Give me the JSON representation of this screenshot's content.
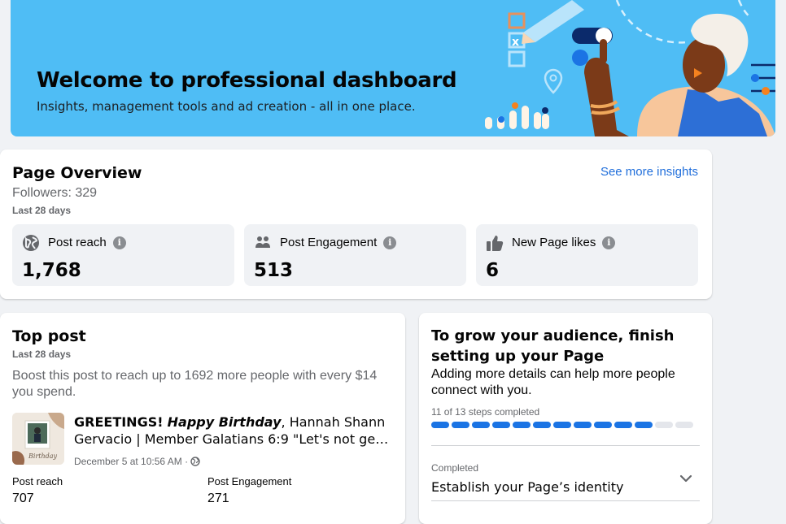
{
  "banner": {
    "title": "Welcome to professional dashboard",
    "subtitle": "Insights, management tools and ad creation - all in one place."
  },
  "overview": {
    "title": "Page Overview",
    "followers": "Followers: 329",
    "period": "Last 28 days",
    "link": "See more insights",
    "metrics": [
      {
        "icon": "globe-icon",
        "label": "Post reach",
        "value": "1,768"
      },
      {
        "icon": "people-icon",
        "label": "Post Engagement",
        "value": "513"
      },
      {
        "icon": "thumbs-up-icon",
        "label": "New Page likes",
        "value": "6"
      }
    ]
  },
  "top_post": {
    "title": "Top post",
    "period": "Last 28 days",
    "boost": "Boost this post to reach up to 1692 more people with every $14 you spend.",
    "text_bold": "GREETINGS!",
    "text_italic": "Happy Birthday",
    "text_rest": ", Hannah Shann",
    "text_line2": "Gervacio | Member Galatians 6:9 \"Let's not get...",
    "date": "December 5 at 10:56 AM · ",
    "stats": [
      {
        "label": "Post reach",
        "value": "707"
      },
      {
        "label": "Post Engagement",
        "value": "271"
      }
    ]
  },
  "grow": {
    "title": "To grow your audience, finish setting up your Page",
    "desc": "Adding more details can help more people connect with you.",
    "steps": "11 of 13 steps completed",
    "completed_steps": 11,
    "total_steps": 13,
    "status": "Completed",
    "item": "Establish your Page’s identity"
  },
  "colors": {
    "accent": "#1b74e4",
    "banner": "#4fbdf5",
    "link": "#216fdb"
  }
}
